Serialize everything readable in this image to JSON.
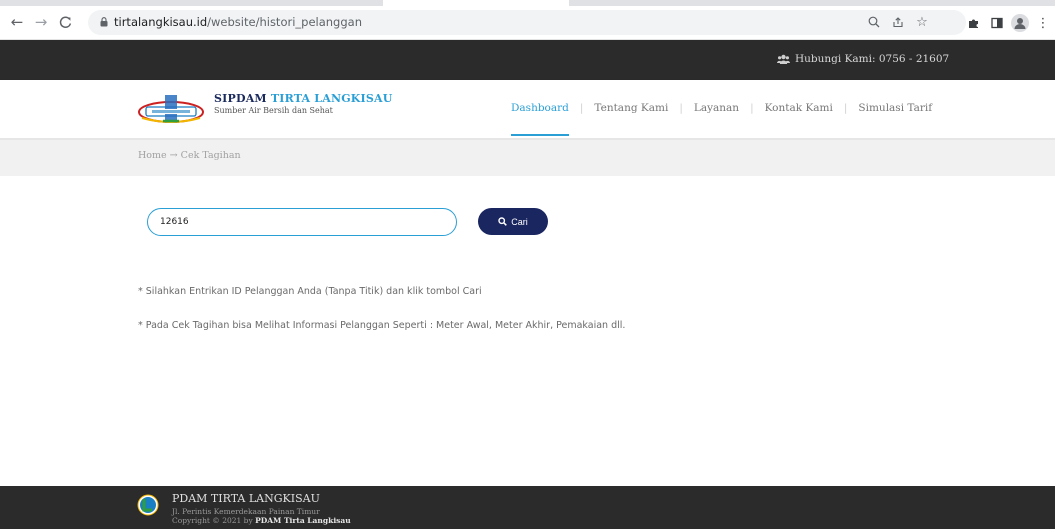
{
  "browser": {
    "url_host": "tirtalangkisau.id",
    "url_path": "/website/histori_pelanggan"
  },
  "topbar": {
    "contact": "Hubungi Kami: 0756 - 21607"
  },
  "brand": {
    "name_part1": "SIPDAM",
    "name_part2": "TIRTA LANGKISAU",
    "tagline": "Sumber Air Bersih dan Sehat"
  },
  "nav": {
    "items": [
      {
        "label": "Dashboard",
        "active": true
      },
      {
        "label": "Tentang Kami",
        "active": false
      },
      {
        "label": "Layanan",
        "active": false
      },
      {
        "label": "Kontak Kami",
        "active": false
      },
      {
        "label": "Simulasi Tarif",
        "active": false
      }
    ]
  },
  "breadcrumb": {
    "home": "Home",
    "arrow": "→",
    "current": "Cek Tagihan"
  },
  "search": {
    "value": "12616",
    "button_label": "Cari"
  },
  "notes": [
    "* Silahkan Entrikan ID Pelanggan Anda (Tanpa Titik) dan klik tombol Cari",
    "* Pada Cek Tagihan bisa Melihat Informasi Pelanggan Seperti : Meter Awal, Meter Akhir, Pemakaian dll."
  ],
  "footer": {
    "title": "PDAM TIRTA LANGKISAU",
    "address": "Jl. Perintis Kemerdekaan Painan Timur",
    "copyright_prefix": "Copyright © 2021 by",
    "copyright_owner": "PDAM Tirta Langkisau"
  },
  "colors": {
    "accent": "#2a9fd6",
    "navy": "#1a2660",
    "dark_bar": "#2b2b2b"
  },
  "icons": {
    "back": "arrow-left-icon",
    "forward": "arrow-right-icon",
    "reload": "reload-icon",
    "lock": "lock-icon",
    "zoom": "zoom-icon",
    "share": "share-icon",
    "bookmark": "star-icon",
    "extensions": "puzzle-icon",
    "sidepanel": "sidepanel-icon",
    "profile": "profile-icon",
    "menu": "kebab-menu-icon",
    "contact": "users-icon",
    "search": "search-icon"
  }
}
